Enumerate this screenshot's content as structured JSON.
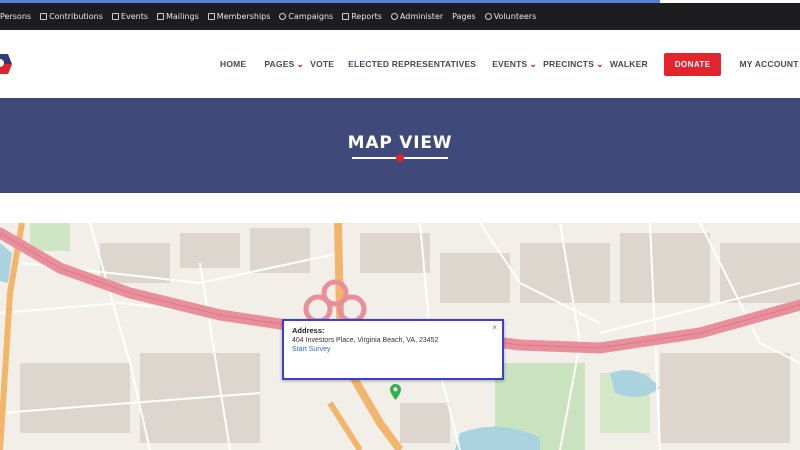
{
  "admin_bar": {
    "items": [
      {
        "label": "Persons",
        "icon": "person-icon"
      },
      {
        "label": "Contributions",
        "icon": "contributions-icon"
      },
      {
        "label": "Events",
        "icon": "calendar-icon"
      },
      {
        "label": "Mailings",
        "icon": "mail-icon"
      },
      {
        "label": "Memberships",
        "icon": "membership-icon"
      },
      {
        "label": "Campaigns",
        "icon": "megaphone-icon"
      },
      {
        "label": "Reports",
        "icon": "chart-icon"
      },
      {
        "label": "Administer",
        "icon": "wrench-icon"
      },
      {
        "label": "Pages",
        "icon": ""
      },
      {
        "label": "Volunteers",
        "icon": "heart-icon"
      }
    ]
  },
  "nav": {
    "home": "HOME",
    "pages": "PAGES",
    "vote": "VOTE",
    "elected": "ELECTED REPRESENTATIVES",
    "events": "EVENTS",
    "precincts": "PRECINCTS",
    "walker": "WALKER",
    "donate": "DONATE",
    "account": "MY ACCOUNT"
  },
  "banner": {
    "title": "MAP VIEW"
  },
  "popup": {
    "label": "Address:",
    "address": "404 Investors Place, Virginia Beach, VA, 23452",
    "link": "Start Survey",
    "close": "×"
  },
  "colors": {
    "accent": "#e3232d",
    "banner": "#3f4a7a",
    "popup_border": "#3a3fd1",
    "highway": "#e98f9c"
  }
}
